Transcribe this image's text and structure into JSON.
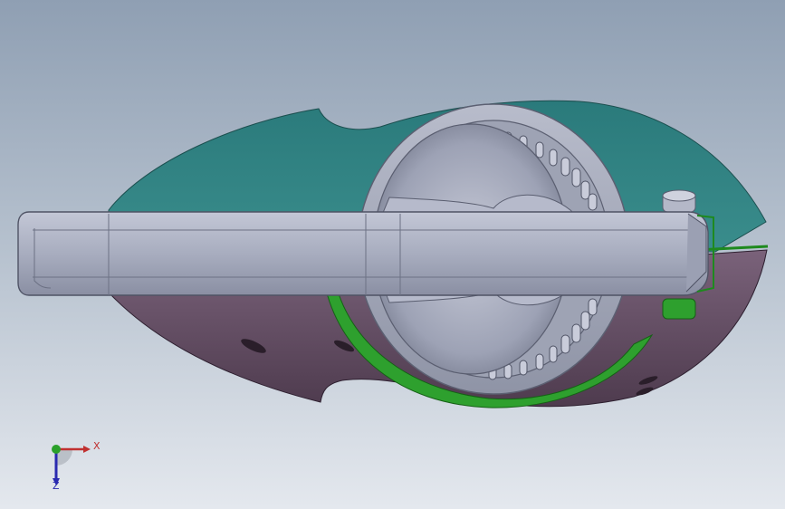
{
  "viewport": {
    "background_top": "#8f9fb3",
    "background_bottom": "#e4e8ee"
  },
  "model": {
    "colors": {
      "teal": "#2f7f7f",
      "purple": "#6f566e",
      "green": "#2ea02e",
      "metal": "#a7acbe",
      "metal_dark": "#7d8294",
      "metal_light": "#c9ccda"
    }
  },
  "triad": {
    "x_label": "X",
    "z_label": "Z",
    "x_color": "#c03030",
    "y_color": "#2aa02a",
    "z_color": "#2a2ab0"
  }
}
